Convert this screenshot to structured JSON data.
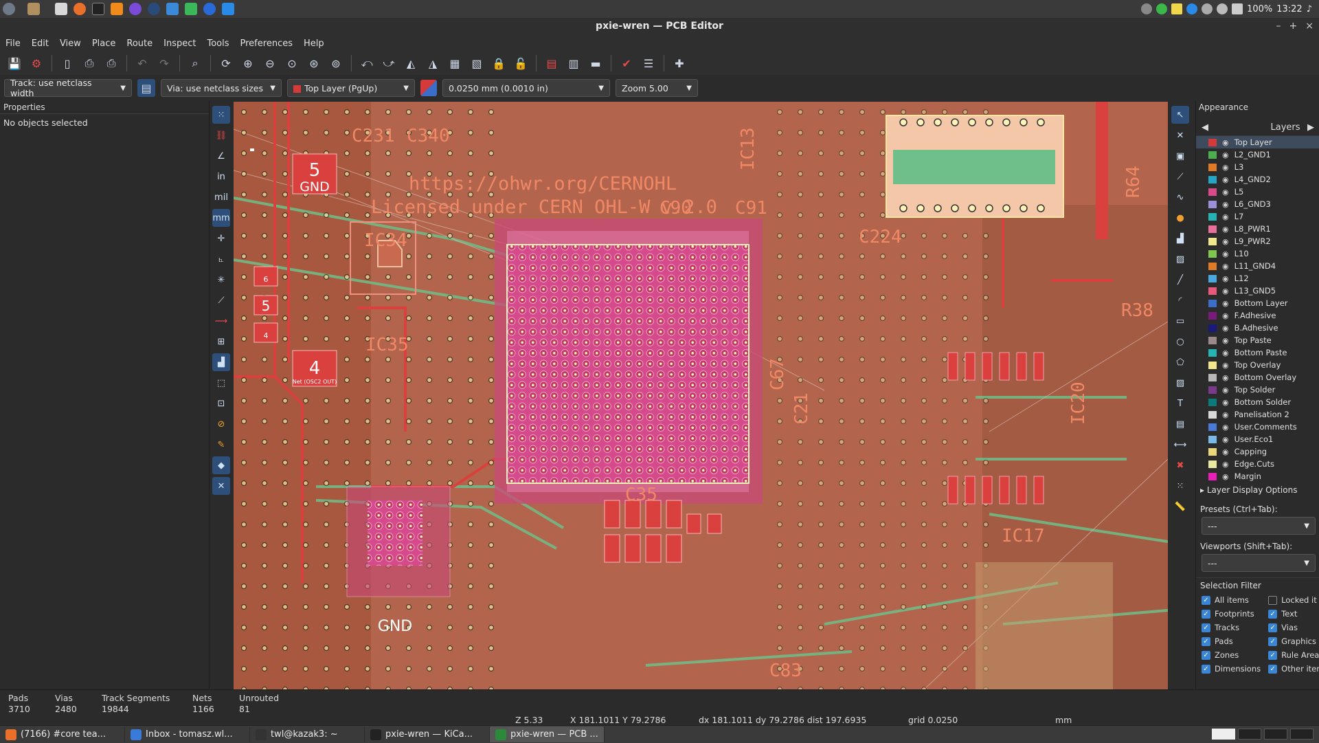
{
  "window": {
    "title": "pxie-wren — PCB Editor"
  },
  "system": {
    "battery": "100%",
    "clock": "13:22"
  },
  "menu": [
    "File",
    "Edit",
    "View",
    "Place",
    "Route",
    "Inspect",
    "Tools",
    "Preferences",
    "Help"
  ],
  "combos": {
    "track": "Track: use netclass width",
    "via": "Via: use netclass sizes",
    "layer": "Top Layer (PgUp)",
    "grid": "0.0250 mm (0.0010 in)",
    "zoom": "Zoom 5.00"
  },
  "properties": {
    "header": "Properties",
    "empty": "No objects selected"
  },
  "lefttools": {
    "in": "in",
    "mil": "mil",
    "mm": "mm"
  },
  "canvas": {
    "url": "https://ohwr.org/CERNOHL",
    "license": "Licensed under CERN OHL-W v.2.0",
    "refs": [
      "C231",
      "C340",
      "C90",
      "C91",
      "IC13",
      "IC34",
      "IC35",
      "C224",
      "R64",
      "R38",
      "IC20",
      "IC17",
      "C35",
      "C21",
      "C67",
      "C83"
    ],
    "pad_labels": {
      "five": "5",
      "gnd": "GND",
      "four": "4",
      "net_osc2": "Net (OSC2 OUT)",
      "six": "6",
      "gnd_bottom": "GND"
    }
  },
  "appearance": {
    "header": "Appearance",
    "tab": "Layers",
    "layers": [
      {
        "name": "Top Layer",
        "color": "#d43a3a"
      },
      {
        "name": "L2_GND1",
        "color": "#4caf50"
      },
      {
        "name": "L3",
        "color": "#e07a26"
      },
      {
        "name": "L4_GND2",
        "color": "#26a6c4"
      },
      {
        "name": "L5",
        "color": "#d94a8a"
      },
      {
        "name": "L6_GND3",
        "color": "#9a8fd8"
      },
      {
        "name": "L7",
        "color": "#26b3b3"
      },
      {
        "name": "L8_PWR1",
        "color": "#e86f9a"
      },
      {
        "name": "L9_PWR2",
        "color": "#f0e68c"
      },
      {
        "name": "L10",
        "color": "#7ec850"
      },
      {
        "name": "L11_GND4",
        "color": "#e07a26"
      },
      {
        "name": "L12",
        "color": "#4aa8e0"
      },
      {
        "name": "L13_GND5",
        "color": "#e8587a"
      },
      {
        "name": "Bottom Layer",
        "color": "#3a6ec8"
      },
      {
        "name": "F.Adhesive",
        "color": "#7a1a7a"
      },
      {
        "name": "B.Adhesive",
        "color": "#1a1a7a"
      },
      {
        "name": "Top Paste",
        "color": "#9a8a8a"
      },
      {
        "name": "Bottom Paste",
        "color": "#26b3b3"
      },
      {
        "name": "Top Overlay",
        "color": "#f0e68c"
      },
      {
        "name": "Bottom Overlay",
        "color": "#b8b8b8"
      },
      {
        "name": "Top Solder",
        "color": "#7a3a8a"
      },
      {
        "name": "Bottom Solder",
        "color": "#0a7a7a"
      },
      {
        "name": "Panelisation 2",
        "color": "#d8d8d8"
      },
      {
        "name": "User.Comments",
        "color": "#4a7ad8"
      },
      {
        "name": "User.Eco1",
        "color": "#7ab8e8"
      },
      {
        "name": "Capping",
        "color": "#e8d87a"
      },
      {
        "name": "Edge.Cuts",
        "color": "#e8e8a0"
      },
      {
        "name": "Margin",
        "color": "#e820b8"
      }
    ],
    "display_options": "Layer Display Options",
    "presets_label": "Presets (Ctrl+Tab):",
    "presets_value": "---",
    "viewports_label": "Viewports (Shift+Tab):",
    "viewports_value": "---",
    "selection_filter": "Selection Filter",
    "filters_left": [
      "All items",
      "Footprints",
      "Tracks",
      "Pads",
      "Zones",
      "Dimensions"
    ],
    "filters_right": [
      "Locked it",
      "Text",
      "Vias",
      "Graphics",
      "Rule Area",
      "Other iter"
    ]
  },
  "status": {
    "pads_label": "Pads",
    "pads": "3710",
    "vias_label": "Vias",
    "vias": "2480",
    "tracks_label": "Track Segments",
    "tracks": "19844",
    "nets_label": "Nets",
    "nets": "1166",
    "unrouted_label": "Unrouted",
    "unrouted": "81",
    "zoom": "Z 5.33",
    "xy": "X 181.1011  Y 79.2786",
    "dxy": "dx 181.1011  dy 79.2786  dist 197.6935",
    "grid": "grid 0.0250",
    "units": "mm"
  },
  "taskbar": [
    {
      "label": "(7166) #core tea...",
      "color": "#e8702a"
    },
    {
      "label": "Inbox - tomasz.wl...",
      "color": "#3a7ad8"
    },
    {
      "label": "twl@kazak3: ~",
      "color": "#333333"
    },
    {
      "label": "pxie-wren — KiCa...",
      "color": "#222222"
    },
    {
      "label": "pxie-wren — PCB ...",
      "color": "#2a8a3a"
    }
  ]
}
